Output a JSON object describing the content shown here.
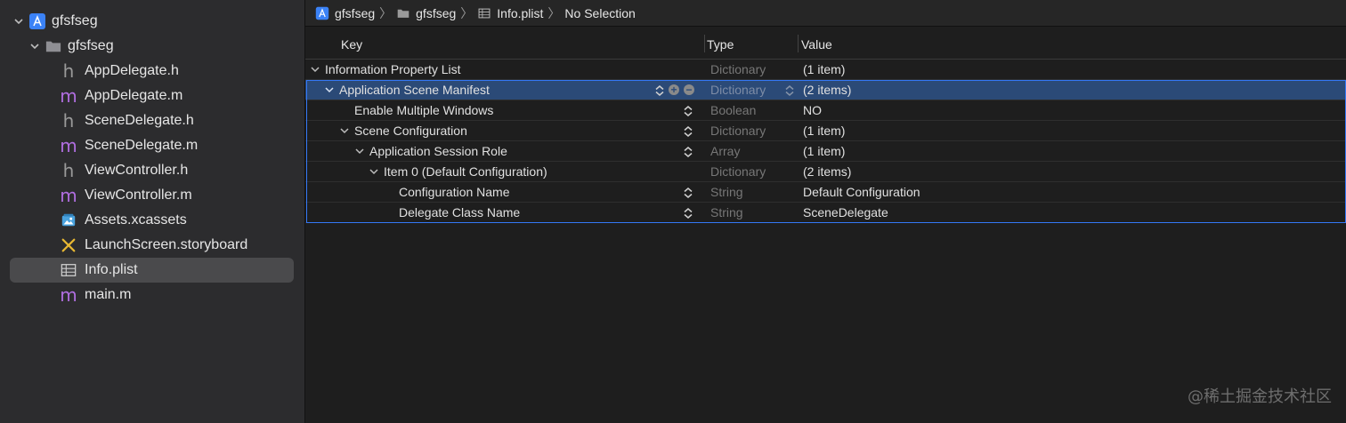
{
  "sidebar": {
    "project": "gfsfseg",
    "group": "gfsfseg",
    "files": [
      {
        "name": "AppDelegate.h",
        "kind": "h"
      },
      {
        "name": "AppDelegate.m",
        "kind": "m"
      },
      {
        "name": "SceneDelegate.h",
        "kind": "h"
      },
      {
        "name": "SceneDelegate.m",
        "kind": "m"
      },
      {
        "name": "ViewController.h",
        "kind": "h"
      },
      {
        "name": "ViewController.m",
        "kind": "m"
      },
      {
        "name": "Assets.xcassets",
        "kind": "assets"
      },
      {
        "name": "LaunchScreen.storyboard",
        "kind": "storyboard"
      },
      {
        "name": "Info.plist",
        "kind": "plist",
        "selected": true
      },
      {
        "name": "main.m",
        "kind": "m"
      }
    ]
  },
  "breadcrumb": {
    "project": "gfsfseg",
    "group": "gfsfseg",
    "file": "Info.plist",
    "selection": "No Selection"
  },
  "plist": {
    "headers": {
      "key": "Key",
      "type": "Type",
      "value": "Value"
    },
    "rows": [
      {
        "key": "Information Property List",
        "type": "Dictionary",
        "value": "(1 item)"
      },
      {
        "key": "Application Scene Manifest",
        "type": "Dictionary",
        "value": "(2 items)"
      },
      {
        "key": "Enable Multiple Windows",
        "type": "Boolean",
        "value": "NO"
      },
      {
        "key": "Scene Configuration",
        "type": "Dictionary",
        "value": "(1 item)"
      },
      {
        "key": "Application Session Role",
        "type": "Array",
        "value": "(1 item)"
      },
      {
        "key": "Item 0 (Default Configuration)",
        "type": "Dictionary",
        "value": "(2 items)"
      },
      {
        "key": "Configuration Name",
        "type": "String",
        "value": "Default Configuration"
      },
      {
        "key": "Delegate Class Name",
        "type": "String",
        "value": "SceneDelegate"
      }
    ]
  },
  "watermark": "@稀土掘金技术社区"
}
